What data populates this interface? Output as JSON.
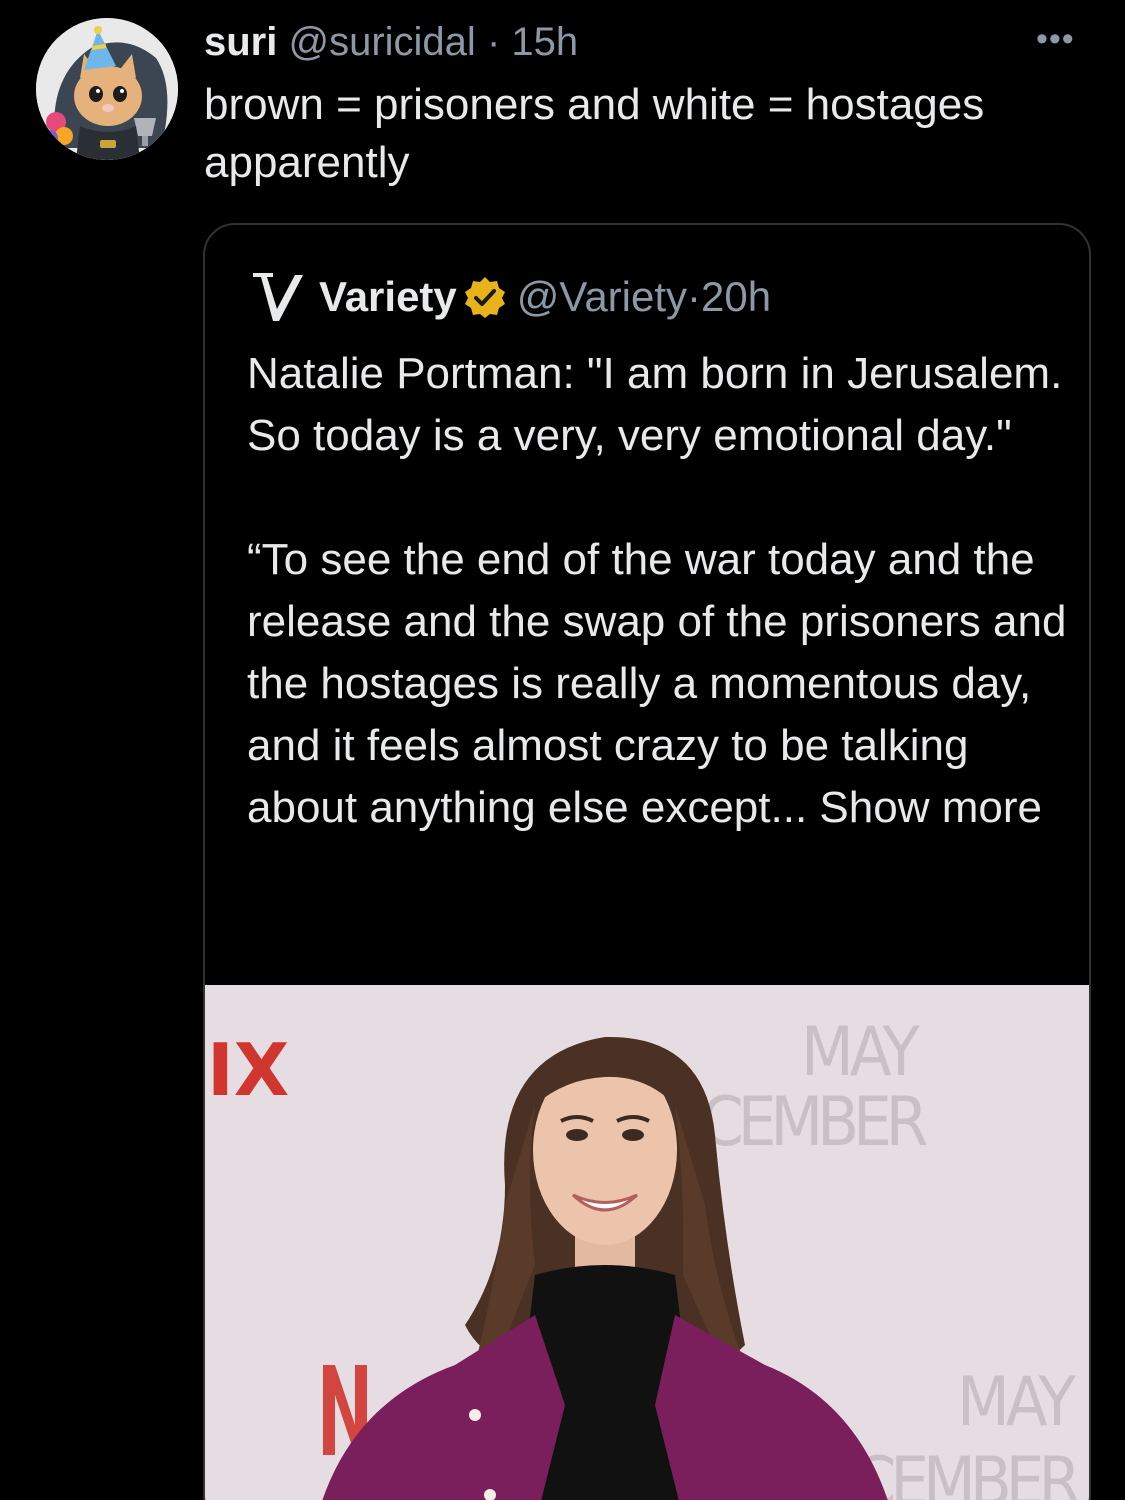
{
  "tweet": {
    "author_name": "suri",
    "author_handle": "@suricidal",
    "separator": "·",
    "time": "15h",
    "more_label": "•••",
    "lines": [
      "brown = prisoners and white = hostages",
      "apparently"
    ]
  },
  "quote": {
    "author_name": "Variety",
    "author_handle": "@Variety",
    "separator": "·",
    "time": "20h",
    "paragraph1": "Natalie Portman: \"I am born in Jerusalem. So today is a very, very emotional day.\"",
    "paragraph2": "“To see the end of the war today and the release and the swap of the prisoners and the hostages is really a momentous day, and it feels almost crazy to be talking about anything else except...",
    "show_more": "Show more"
  },
  "photo": {
    "backdrop_text_left": "IX",
    "backdrop_text_top": [
      "MAY",
      "CEMBER"
    ],
    "backdrop_text_bottom": [
      "MAY",
      "ECEMBER"
    ]
  },
  "colors": {
    "background": "#000000",
    "text_primary": "#e7e9ea",
    "text_secondary": "#8b98a5",
    "border": "#2f3336",
    "verified_gold": "#e8b21a",
    "backdrop": "#e6dde3",
    "netflix_red": "#d0352e",
    "blazer": "#7b1f5c"
  },
  "icons": {
    "avatar": "cat-avatar-icon",
    "more": "more-options-icon",
    "logo": "variety-logo-icon",
    "verified": "verified-badge-icon"
  }
}
